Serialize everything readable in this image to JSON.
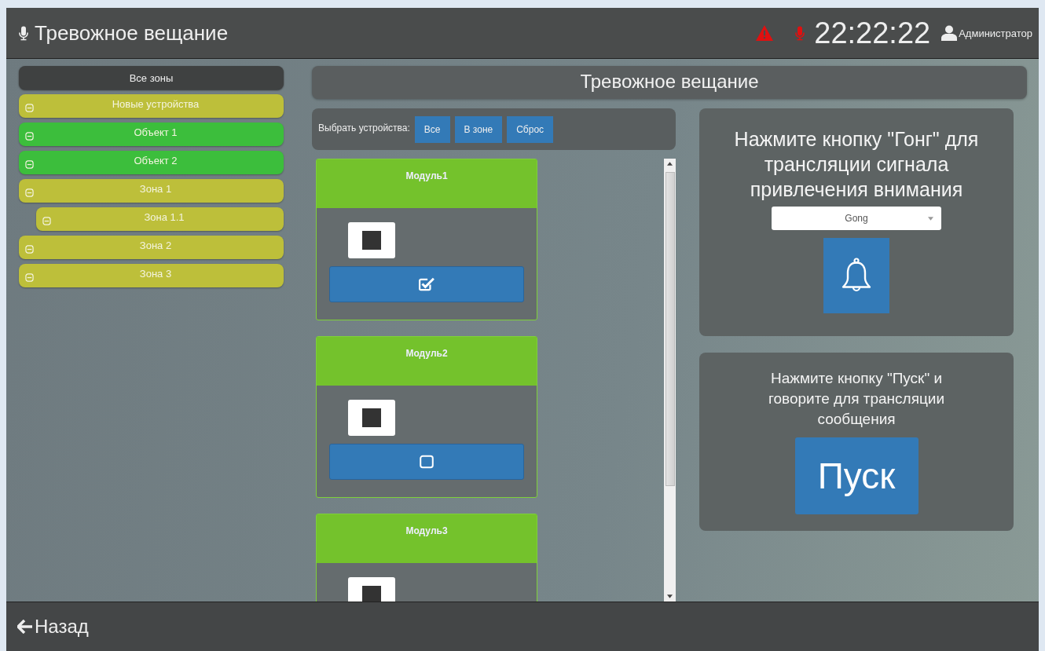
{
  "header": {
    "title": "Тревожное вещание",
    "time": "22:22:22",
    "user": "Администратор",
    "alarm_active": true,
    "mic_active": true
  },
  "sidebar": {
    "all_zones": {
      "label": "Все зоны",
      "selected": true
    },
    "items": [
      {
        "label": "Новые устройства",
        "color": "#bdbf3a"
      },
      {
        "label": "Объект 1",
        "color": "#3cbe3c"
      },
      {
        "label": "Объект 2",
        "color": "#3cbe3c"
      },
      {
        "label": "Зона 1",
        "color": "#bdbf3a",
        "children": [
          {
            "label": "Зона 1.1",
            "color": "#bdbf3a"
          }
        ]
      },
      {
        "label": "Зона 2",
        "color": "#bdbf3a"
      },
      {
        "label": "Зона 3",
        "color": "#bdbf3a"
      }
    ]
  },
  "main": {
    "title": "Тревожное вещание",
    "select_bar": {
      "label": "Выбрать устройства:",
      "buttons": [
        "Все",
        "В зоне",
        "Сброс"
      ]
    },
    "modules": [
      {
        "name": "Модуль1",
        "checked": true
      },
      {
        "name": "Модуль2",
        "checked": false
      },
      {
        "name": "Модуль3"
      }
    ],
    "gong_card": {
      "text": "Нажмите кнопку \"Гонг\" для трансляции сигнала привлечения внимания",
      "sound": "Gong"
    },
    "start_card": {
      "text": "Нажмите кнопку \"Пуск\" и говорите для трансляции сообщения",
      "button": "Пуск"
    }
  },
  "footer": {
    "back": "Назад"
  }
}
